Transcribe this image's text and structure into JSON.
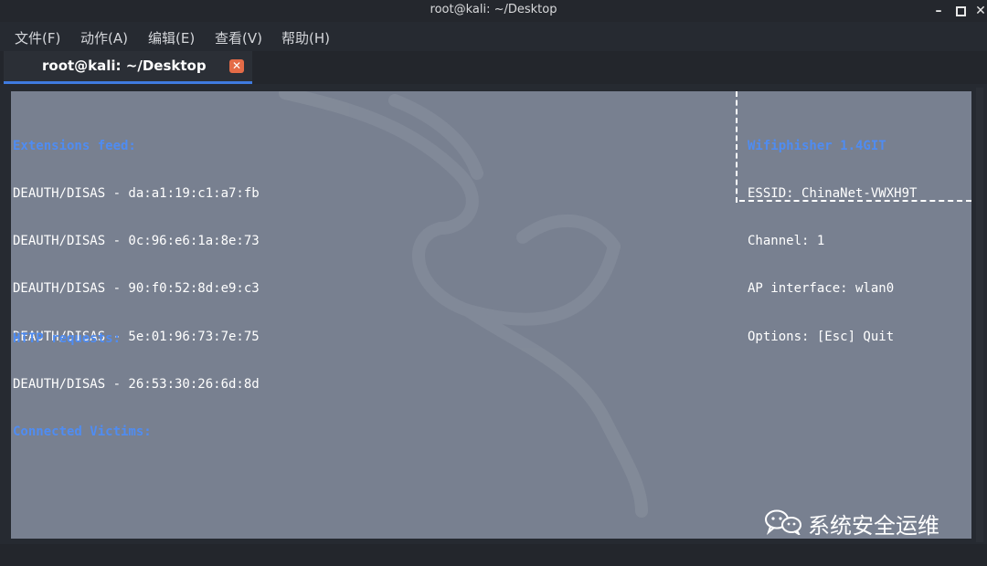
{
  "window": {
    "title": "root@kali: ~/Desktop",
    "controls": {
      "minimize": "–",
      "close": "✕"
    }
  },
  "menu": {
    "items": [
      "文件(F)",
      "动作(A)",
      "编辑(E)",
      "查看(V)",
      "帮助(H)"
    ]
  },
  "tab": {
    "label": "root@kali: ~/Desktop",
    "close_glyph": "✕"
  },
  "terminal": {
    "extensions_header": "Extensions feed:",
    "feed": [
      "DEAUTH/DISAS - da:a1:19:c1:a7:fb",
      "DEAUTH/DISAS - 0c:96:e6:1a:8e:73",
      "DEAUTH/DISAS - 90:f0:52:8d:e9:c3",
      "DEAUTH/DISAS - 5e:01:96:73:7e:75",
      "DEAUTH/DISAS - 26:53:30:26:6d:8d"
    ],
    "victims_header": "Connected Victims:",
    "http_header": "HTTP requests:",
    "info": {
      "app_name": "Wifiphisher 1.4GIT",
      "essid": "ESSID: ChinaNet-VWXH9T",
      "channel": "Channel: 1",
      "ap_interface": "AP interface: wlan0",
      "options": "Options: [Esc] Quit"
    }
  },
  "watermark": {
    "text": "系统安全运维",
    "icon": "wechat-icon"
  },
  "colors": {
    "window_bg": "#262a31",
    "terminal_bg": "#788090",
    "accent": "#3f7be0",
    "header_blue": "#4f8cf2",
    "tab_close": "#e46b47"
  }
}
